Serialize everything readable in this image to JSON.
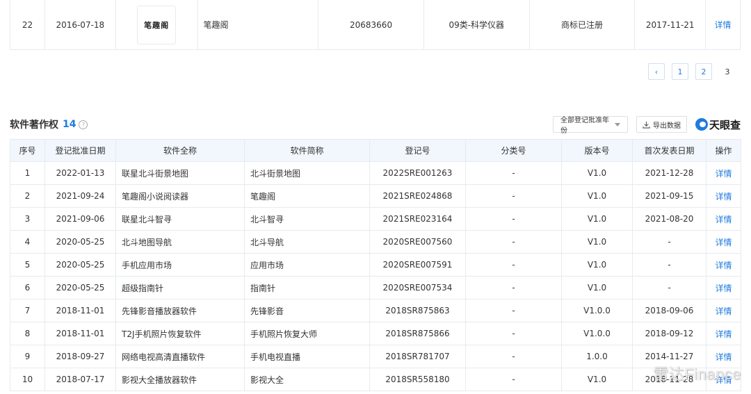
{
  "trademark_row": {
    "index": "22",
    "apply_date": "2016-07-18",
    "logo_text": "笔趣阁",
    "name": "笔趣阁",
    "reg_no": "20683660",
    "category": "09类-科学仪器",
    "status": "商标已注册",
    "date": "2017-11-21",
    "action": "详情"
  },
  "pagination": {
    "prev_icon": "chevron-left-icon",
    "pages": [
      "1",
      "2"
    ],
    "current": "3"
  },
  "software_section": {
    "title": "软件著作权",
    "count": "14",
    "help_symbol": "?",
    "year_filter": "全部登记批准年份",
    "export_label": "导出数据",
    "brand_text": "天眼查",
    "columns": [
      "序号",
      "登记批准日期",
      "软件全称",
      "软件简称",
      "登记号",
      "分类号",
      "版本号",
      "首次发表日期",
      "操作"
    ],
    "rows": [
      {
        "no": "1",
        "approve_date": "2022-01-13",
        "full_name": "联星北斗街景地图",
        "short_name": "北斗街景地图",
        "reg_no": "2022SRE001263",
        "class_no": "-",
        "version": "V1.0",
        "publish_date": "2021-12-28",
        "action": "详情"
      },
      {
        "no": "2",
        "approve_date": "2021-09-24",
        "full_name": "笔趣阁小说阅读器",
        "short_name": "笔趣阁",
        "reg_no": "2021SRE024868",
        "class_no": "-",
        "version": "V1.0",
        "publish_date": "2021-09-15",
        "action": "详情"
      },
      {
        "no": "3",
        "approve_date": "2021-09-06",
        "full_name": "联星北斗智寻",
        "short_name": "北斗智寻",
        "reg_no": "2021SRE023164",
        "class_no": "-",
        "version": "V1.0",
        "publish_date": "2021-08-20",
        "action": "详情"
      },
      {
        "no": "4",
        "approve_date": "2020-05-25",
        "full_name": "北斗地图导航",
        "short_name": "北斗导航",
        "reg_no": "2020SRE007560",
        "class_no": "-",
        "version": "V1.0",
        "publish_date": "-",
        "action": "详情"
      },
      {
        "no": "5",
        "approve_date": "2020-05-25",
        "full_name": "手机应用市场",
        "short_name": "应用市场",
        "reg_no": "2020SRE007591",
        "class_no": "-",
        "version": "V1.0",
        "publish_date": "-",
        "action": "详情"
      },
      {
        "no": "6",
        "approve_date": "2020-05-25",
        "full_name": "超级指南针",
        "short_name": "指南针",
        "reg_no": "2020SRE007534",
        "class_no": "-",
        "version": "V1.0",
        "publish_date": "-",
        "action": "详情"
      },
      {
        "no": "7",
        "approve_date": "2018-11-01",
        "full_name": "先锋影音播放器软件",
        "short_name": "先锋影音",
        "reg_no": "2018SR875863",
        "class_no": "-",
        "version": "V1.0.0",
        "publish_date": "2018-09-06",
        "action": "详情"
      },
      {
        "no": "8",
        "approve_date": "2018-11-01",
        "full_name": "T2J手机照片恢复软件",
        "short_name": "手机照片恢复大师",
        "reg_no": "2018SR875866",
        "class_no": "-",
        "version": "V1.0.0",
        "publish_date": "2018-09-12",
        "action": "详情"
      },
      {
        "no": "9",
        "approve_date": "2018-09-27",
        "full_name": "网络电视高清直播软件",
        "short_name": "手机电视直播",
        "reg_no": "2018SR781707",
        "class_no": "-",
        "version": "1.0.0",
        "publish_date": "2014-11-27",
        "action": "详情"
      },
      {
        "no": "10",
        "approve_date": "2018-07-17",
        "full_name": "影视大全播放器软件",
        "short_name": "影视大全",
        "reg_no": "2018SR558180",
        "class_no": "-",
        "version": "V1.0",
        "publish_date": "2018-11-28",
        "action": "详情"
      }
    ]
  },
  "watermark": "雷达Finance",
  "colors": {
    "link": "#1e7be0",
    "header_bg": "#f2f7fd",
    "border": "#e6eaf0"
  }
}
